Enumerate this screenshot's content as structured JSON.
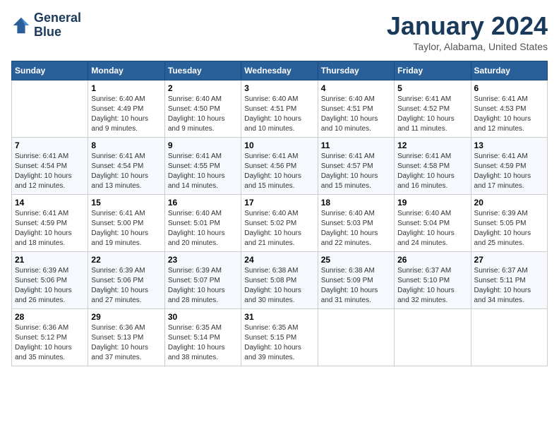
{
  "logo": {
    "line1": "General",
    "line2": "Blue"
  },
  "title": "January 2024",
  "subtitle": "Taylor, Alabama, United States",
  "weekdays": [
    "Sunday",
    "Monday",
    "Tuesday",
    "Wednesday",
    "Thursday",
    "Friday",
    "Saturday"
  ],
  "weeks": [
    [
      {
        "day": "",
        "info": ""
      },
      {
        "day": "1",
        "info": "Sunrise: 6:40 AM\nSunset: 4:49 PM\nDaylight: 10 hours\nand 9 minutes."
      },
      {
        "day": "2",
        "info": "Sunrise: 6:40 AM\nSunset: 4:50 PM\nDaylight: 10 hours\nand 9 minutes."
      },
      {
        "day": "3",
        "info": "Sunrise: 6:40 AM\nSunset: 4:51 PM\nDaylight: 10 hours\nand 10 minutes."
      },
      {
        "day": "4",
        "info": "Sunrise: 6:40 AM\nSunset: 4:51 PM\nDaylight: 10 hours\nand 10 minutes."
      },
      {
        "day": "5",
        "info": "Sunrise: 6:41 AM\nSunset: 4:52 PM\nDaylight: 10 hours\nand 11 minutes."
      },
      {
        "day": "6",
        "info": "Sunrise: 6:41 AM\nSunset: 4:53 PM\nDaylight: 10 hours\nand 12 minutes."
      }
    ],
    [
      {
        "day": "7",
        "info": "Sunrise: 6:41 AM\nSunset: 4:54 PM\nDaylight: 10 hours\nand 12 minutes."
      },
      {
        "day": "8",
        "info": "Sunrise: 6:41 AM\nSunset: 4:54 PM\nDaylight: 10 hours\nand 13 minutes."
      },
      {
        "day": "9",
        "info": "Sunrise: 6:41 AM\nSunset: 4:55 PM\nDaylight: 10 hours\nand 14 minutes."
      },
      {
        "day": "10",
        "info": "Sunrise: 6:41 AM\nSunset: 4:56 PM\nDaylight: 10 hours\nand 15 minutes."
      },
      {
        "day": "11",
        "info": "Sunrise: 6:41 AM\nSunset: 4:57 PM\nDaylight: 10 hours\nand 15 minutes."
      },
      {
        "day": "12",
        "info": "Sunrise: 6:41 AM\nSunset: 4:58 PM\nDaylight: 10 hours\nand 16 minutes."
      },
      {
        "day": "13",
        "info": "Sunrise: 6:41 AM\nSunset: 4:59 PM\nDaylight: 10 hours\nand 17 minutes."
      }
    ],
    [
      {
        "day": "14",
        "info": "Sunrise: 6:41 AM\nSunset: 4:59 PM\nDaylight: 10 hours\nand 18 minutes."
      },
      {
        "day": "15",
        "info": "Sunrise: 6:41 AM\nSunset: 5:00 PM\nDaylight: 10 hours\nand 19 minutes."
      },
      {
        "day": "16",
        "info": "Sunrise: 6:40 AM\nSunset: 5:01 PM\nDaylight: 10 hours\nand 20 minutes."
      },
      {
        "day": "17",
        "info": "Sunrise: 6:40 AM\nSunset: 5:02 PM\nDaylight: 10 hours\nand 21 minutes."
      },
      {
        "day": "18",
        "info": "Sunrise: 6:40 AM\nSunset: 5:03 PM\nDaylight: 10 hours\nand 22 minutes."
      },
      {
        "day": "19",
        "info": "Sunrise: 6:40 AM\nSunset: 5:04 PM\nDaylight: 10 hours\nand 24 minutes."
      },
      {
        "day": "20",
        "info": "Sunrise: 6:39 AM\nSunset: 5:05 PM\nDaylight: 10 hours\nand 25 minutes."
      }
    ],
    [
      {
        "day": "21",
        "info": "Sunrise: 6:39 AM\nSunset: 5:06 PM\nDaylight: 10 hours\nand 26 minutes."
      },
      {
        "day": "22",
        "info": "Sunrise: 6:39 AM\nSunset: 5:06 PM\nDaylight: 10 hours\nand 27 minutes."
      },
      {
        "day": "23",
        "info": "Sunrise: 6:39 AM\nSunset: 5:07 PM\nDaylight: 10 hours\nand 28 minutes."
      },
      {
        "day": "24",
        "info": "Sunrise: 6:38 AM\nSunset: 5:08 PM\nDaylight: 10 hours\nand 30 minutes."
      },
      {
        "day": "25",
        "info": "Sunrise: 6:38 AM\nSunset: 5:09 PM\nDaylight: 10 hours\nand 31 minutes."
      },
      {
        "day": "26",
        "info": "Sunrise: 6:37 AM\nSunset: 5:10 PM\nDaylight: 10 hours\nand 32 minutes."
      },
      {
        "day": "27",
        "info": "Sunrise: 6:37 AM\nSunset: 5:11 PM\nDaylight: 10 hours\nand 34 minutes."
      }
    ],
    [
      {
        "day": "28",
        "info": "Sunrise: 6:36 AM\nSunset: 5:12 PM\nDaylight: 10 hours\nand 35 minutes."
      },
      {
        "day": "29",
        "info": "Sunrise: 6:36 AM\nSunset: 5:13 PM\nDaylight: 10 hours\nand 37 minutes."
      },
      {
        "day": "30",
        "info": "Sunrise: 6:35 AM\nSunset: 5:14 PM\nDaylight: 10 hours\nand 38 minutes."
      },
      {
        "day": "31",
        "info": "Sunrise: 6:35 AM\nSunset: 5:15 PM\nDaylight: 10 hours\nand 39 minutes."
      },
      {
        "day": "",
        "info": ""
      },
      {
        "day": "",
        "info": ""
      },
      {
        "day": "",
        "info": ""
      }
    ]
  ]
}
